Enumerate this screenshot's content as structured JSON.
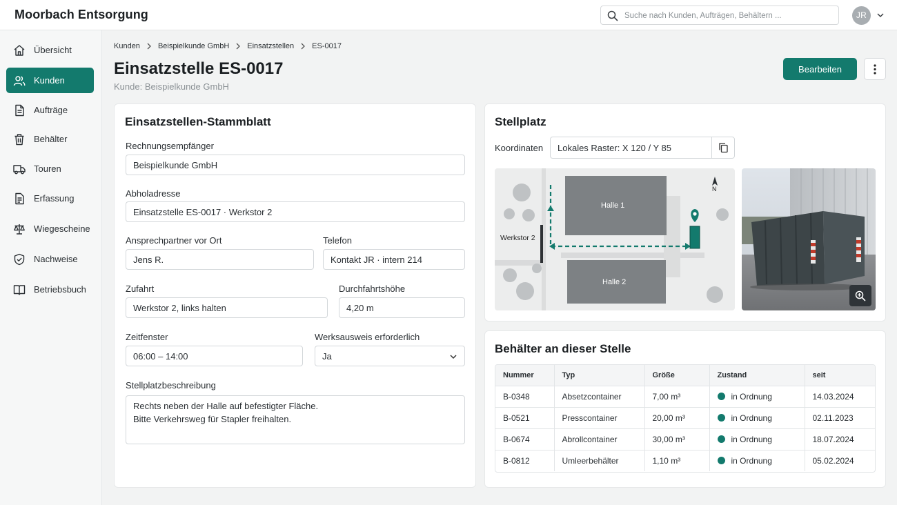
{
  "app": {
    "brand": "Moorbach Entsorgung"
  },
  "search": {
    "placeholder": "Suche nach Kunden, Aufträgen, Behältern ..."
  },
  "user": {
    "initials": "JR"
  },
  "nav": [
    {
      "label": "Übersicht",
      "icon": "home-icon"
    },
    {
      "label": "Kunden",
      "icon": "users-icon",
      "active": true
    },
    {
      "label": "Aufträge",
      "icon": "document-icon"
    },
    {
      "label": "Behälter",
      "icon": "trash-bin-icon"
    },
    {
      "label": "Touren",
      "icon": "truck-icon"
    },
    {
      "label": "Erfassung",
      "icon": "clipboard-icon"
    },
    {
      "label": "Wiegescheine",
      "icon": "scale-icon"
    },
    {
      "label": "Nachweise",
      "icon": "shield-check-icon"
    },
    {
      "label": "Betriebsbuch",
      "icon": "book-icon"
    }
  ],
  "breadcrumb": [
    "Kunden",
    "Beispielkunde GmbH",
    "Einsatzstellen",
    "ES-0017"
  ],
  "page": {
    "title": "Einsatzstelle ES-0017",
    "subtitle": "Kunde: Beispielkunde GmbH"
  },
  "actions": {
    "edit_label": "Bearbeiten"
  },
  "form": {
    "title": "Einsatzstellen-Stammblatt",
    "rechnung": {
      "label": "Rechnungsempfänger",
      "value": "Beispielkunde GmbH"
    },
    "abholadresse": {
      "label": "Abholadresse",
      "value": "Einsatzstelle ES-0017 · Werkstor 2"
    },
    "ansprechpartner": {
      "label": "Ansprechpartner vor Ort",
      "value": "Jens R."
    },
    "telefon": {
      "label": "Telefon",
      "value": "Kontakt JR · intern 214"
    },
    "zufahrt": {
      "label": "Zufahrt",
      "value": "Werkstor 2, links halten"
    },
    "hoehe": {
      "label": "Durchfahrtshöhe",
      "value": "4,20 m"
    },
    "zeitfenster": {
      "label": "Zeitfenster",
      "value": "06:00 – 14:00"
    },
    "werksausweis": {
      "label": "Werksausweis erforderlich",
      "value": "Ja"
    },
    "beschreibung": {
      "label": "Stellplatzbeschreibung",
      "line1": "Rechts neben der Halle auf befestigter Fläche.",
      "line2": "Bitte Verkehrsweg für Stapler freihalten."
    }
  },
  "stellplatz": {
    "title": "Stellplatz",
    "coord_label": "Koordinaten",
    "coord_value": "Lokales Raster: X 120 / Y 85",
    "map": {
      "hall1": "Halle 1",
      "hall2": "Halle 2",
      "gate": "Werkstor 2",
      "north": "N",
      "accent": "#137a6d"
    }
  },
  "containers": {
    "title": "Behälter an dieser Stelle",
    "headers": [
      "Nummer",
      "Typ",
      "Größe",
      "Zustand",
      "seit"
    ],
    "rows": [
      [
        "B-0348",
        "Absetzcontainer",
        "7,00 m³",
        "in Ordnung",
        "14.03.2024"
      ],
      [
        "B-0521",
        "Presscontainer",
        "20,00 m³",
        "in Ordnung",
        "02.11.2023"
      ],
      [
        "B-0674",
        "Abrollcontainer",
        "30,00 m³",
        "in Ordnung",
        "18.07.2024"
      ],
      [
        "B-0812",
        "Umleerbehälter",
        "1,10 m³",
        "in Ordnung",
        "05.02.2024"
      ]
    ]
  },
  "colors": {
    "accent": "#137a6d"
  }
}
